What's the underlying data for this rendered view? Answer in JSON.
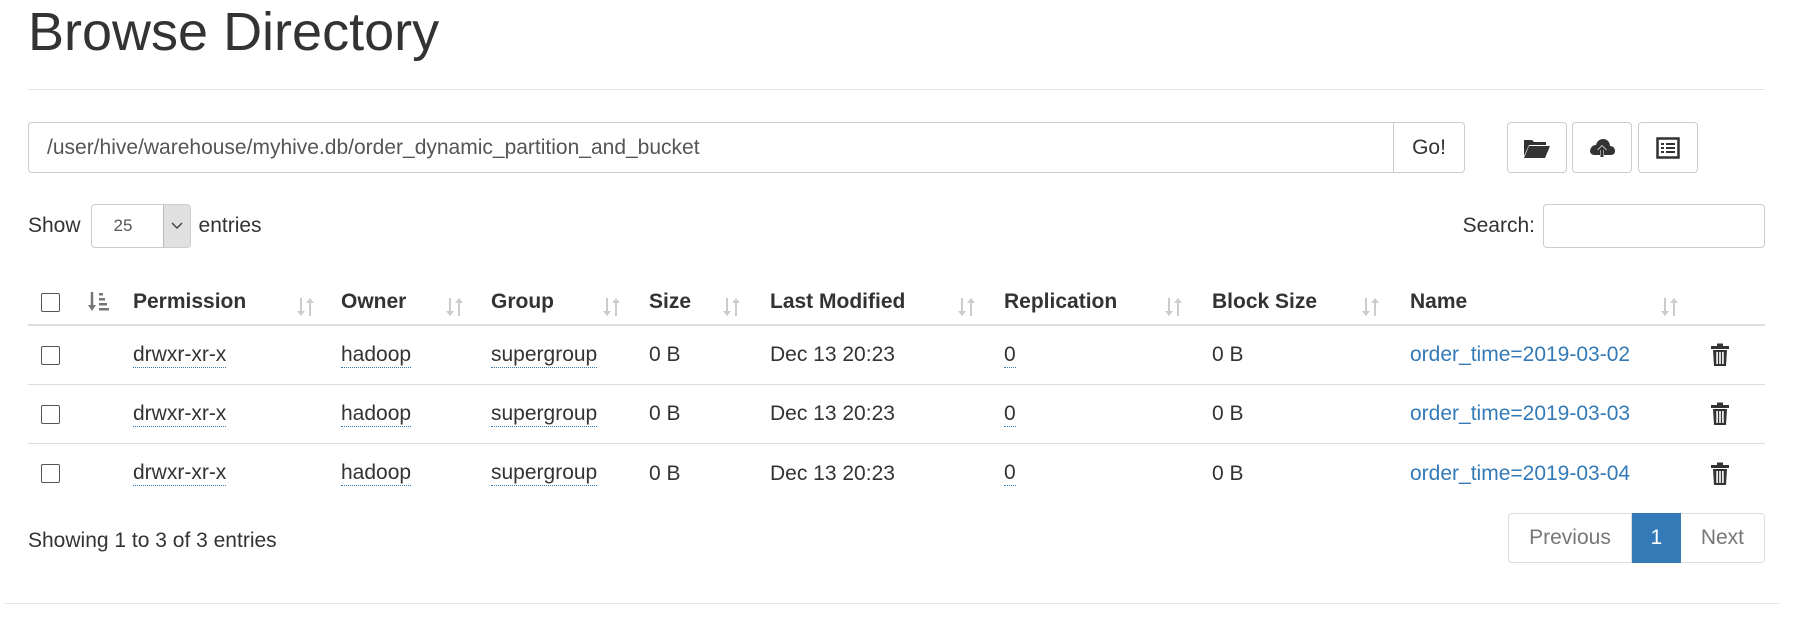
{
  "page": {
    "title": "Browse Directory"
  },
  "path_bar": {
    "value": "/user/hive/warehouse/myhive.db/order_dynamic_partition_and_bucket",
    "go_label": "Go!"
  },
  "toolbar": {
    "icons": [
      "folder-open-icon",
      "cloud-upload-icon",
      "list-alt-icon"
    ]
  },
  "length_menu": {
    "show_label": "Show",
    "selected": "25",
    "entries_label": "entries"
  },
  "search": {
    "label": "Search:",
    "value": ""
  },
  "table": {
    "columns": [
      "Permission",
      "Owner",
      "Group",
      "Size",
      "Last Modified",
      "Replication",
      "Block Size",
      "Name"
    ],
    "rows": [
      {
        "permission": "drwxr-xr-x",
        "owner": "hadoop",
        "group": "supergroup",
        "size": "0 B",
        "last_modified": "Dec 13 20:23",
        "replication": "0",
        "block_size": "0 B",
        "name": "order_time=2019-03-02"
      },
      {
        "permission": "drwxr-xr-x",
        "owner": "hadoop",
        "group": "supergroup",
        "size": "0 B",
        "last_modified": "Dec 13 20:23",
        "replication": "0",
        "block_size": "0 B",
        "name": "order_time=2019-03-03"
      },
      {
        "permission": "drwxr-xr-x",
        "owner": "hadoop",
        "group": "supergroup",
        "size": "0 B",
        "last_modified": "Dec 13 20:23",
        "replication": "0",
        "block_size": "0 B",
        "name": "order_time=2019-03-04"
      }
    ]
  },
  "footer": {
    "info": "Showing 1 to 3 of 3 entries",
    "previous_label": "Previous",
    "current_page": "1",
    "next_label": "Next"
  },
  "colors": {
    "link": "#337ab7",
    "active_page": "#337ab7",
    "border": "#dddddd"
  }
}
